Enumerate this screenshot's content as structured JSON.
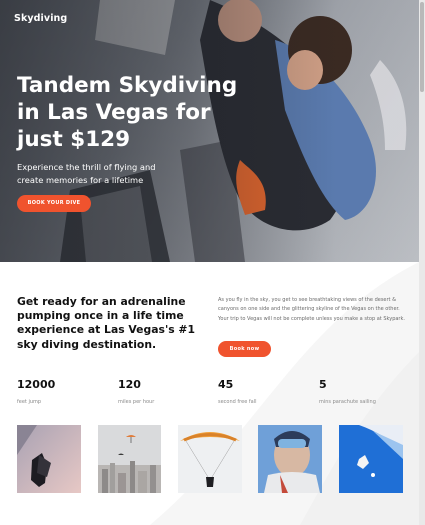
{
  "header": {
    "brand": "Skydiving"
  },
  "hero": {
    "title": "Tandem Skydiving in Las Vegas for just $129",
    "subtitle": "Experience the thrill of flying and create memories for a lifetime",
    "cta_label": "BOOK YOUR DIVE"
  },
  "intro": {
    "heading": "Get ready for an adrenaline pumping once in a life time experience at Las Vegas's #1 sky diving destination.",
    "paragraph": "As you fly in the sky, you get to see breathtaking views of the desert & canyons on one side and the glittering skyline of the Vegas on the other. Your trip to Vegas will not be complete unless you make a stop at Skypark.",
    "cta_label": "Book now"
  },
  "stats": [
    {
      "value": "12000",
      "label": "feet jump"
    },
    {
      "value": "120",
      "label": "miles per hour"
    },
    {
      "value": "45",
      "label": "second free fall"
    },
    {
      "value": "5",
      "label": "mins parachute sailing"
    }
  ],
  "colors": {
    "accent": "#f0532e",
    "text_dark": "#111111",
    "text_muted": "#8a8a8a"
  },
  "photos": [
    {
      "icon": "tandem-jump-photo"
    },
    {
      "icon": "city-parachute-photo"
    },
    {
      "icon": "orange-canopy-photo"
    },
    {
      "icon": "skydiver-portrait-photo"
    },
    {
      "icon": "blue-parachute-photo"
    }
  ]
}
